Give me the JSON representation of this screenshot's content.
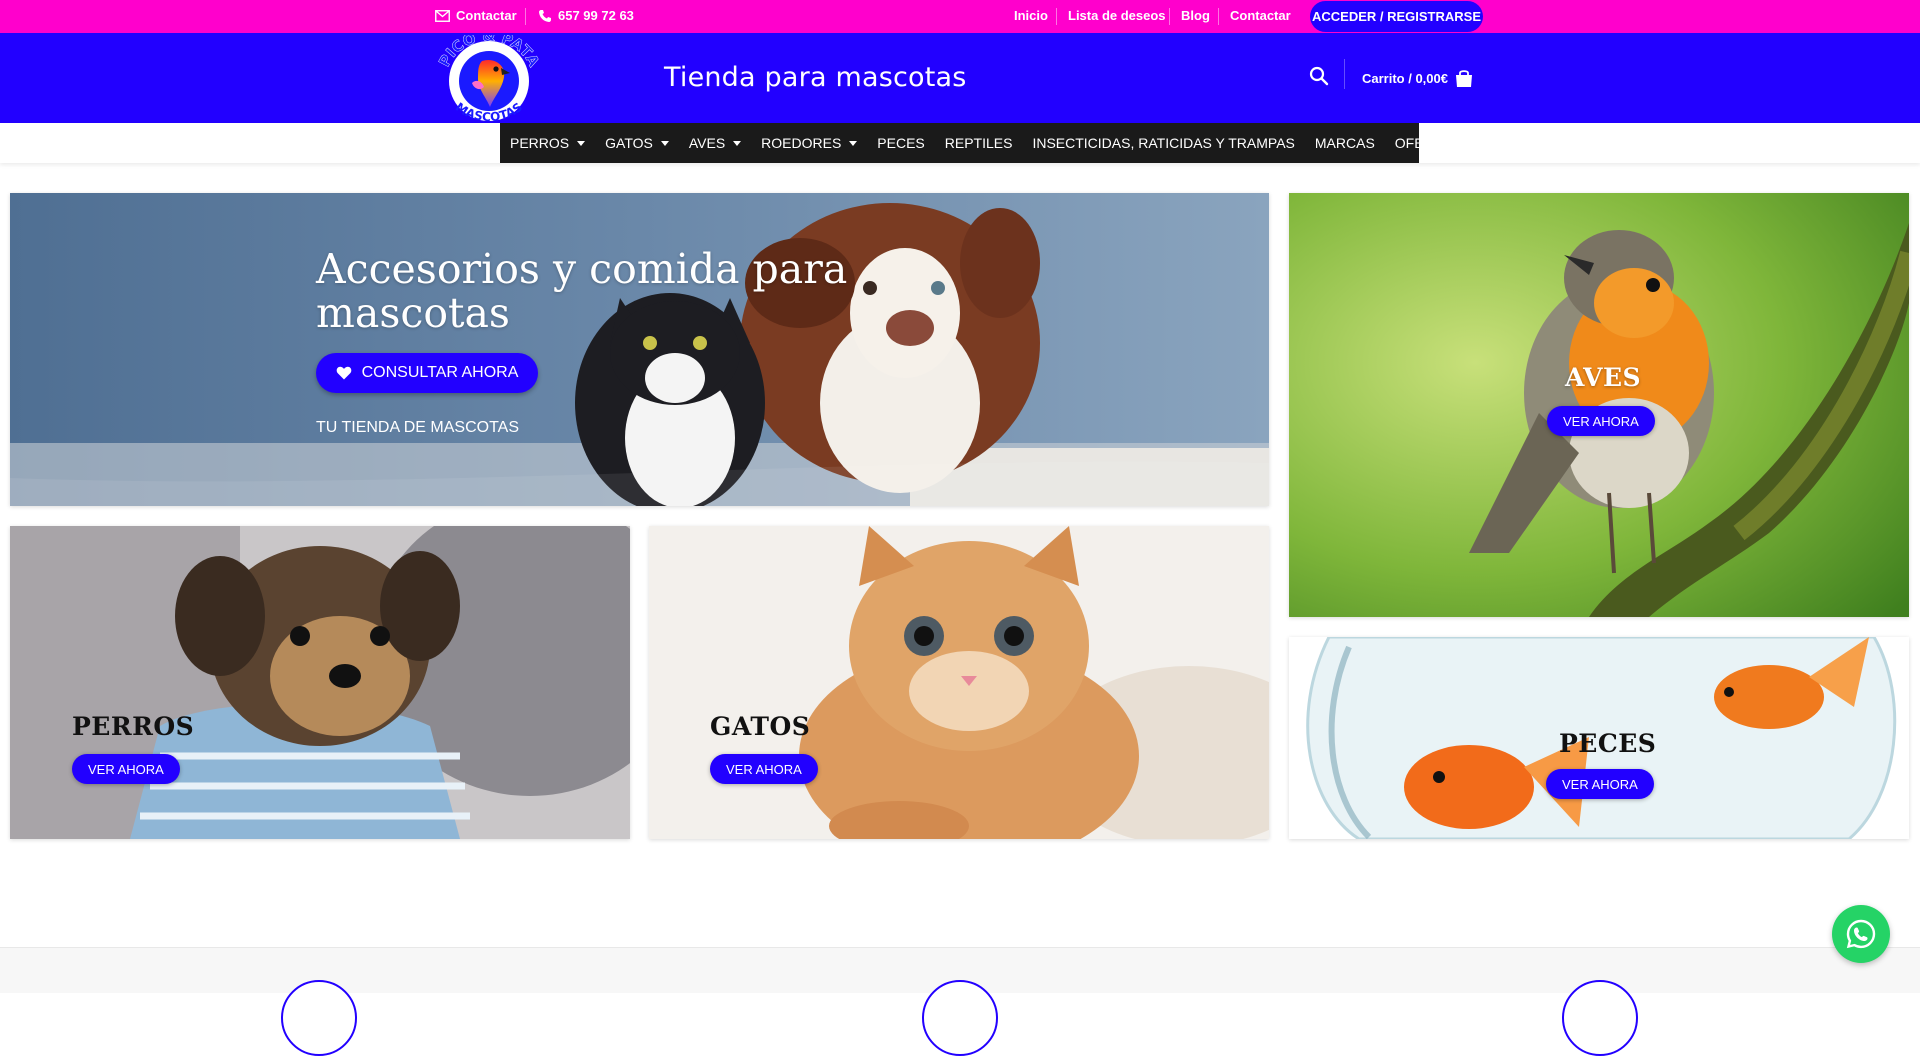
{
  "topbar": {
    "contact_label": "Contactar",
    "phone": "657 99 72 63",
    "links": [
      "Inicio",
      "Lista de deseos",
      "Blog",
      "Contactar"
    ],
    "login_label": "ACCEDER / REGISTRARSE"
  },
  "header": {
    "logo_top_text": "PICO & PATA",
    "logo_bottom_text": "MASCOTAS",
    "tagline": "Tienda para mascotas",
    "cart_label": "Carrito / 0,00€"
  },
  "nav": {
    "items": [
      {
        "label": "PERROS",
        "dropdown": true
      },
      {
        "label": "GATOS",
        "dropdown": true
      },
      {
        "label": "AVES",
        "dropdown": true
      },
      {
        "label": "ROEDORES",
        "dropdown": true
      },
      {
        "label": "PECES",
        "dropdown": false
      },
      {
        "label": "REPTILES",
        "dropdown": false
      },
      {
        "label": "INSECTICIDAS, RATICIDAS Y TRAMPAS",
        "dropdown": false
      },
      {
        "label": "MARCAS",
        "dropdown": false
      },
      {
        "label": "OFERTAS",
        "dropdown": false
      }
    ]
  },
  "hero": {
    "title": "Accesorios y comida para mascotas",
    "button_label": "CONSULTAR AHORA",
    "subtitle": "TU TIENDA DE MASCOTAS"
  },
  "categories": {
    "aves": {
      "title": "AVES",
      "button": "VER AHORA"
    },
    "perros": {
      "title": "PERROS",
      "button": "VER AHORA"
    },
    "gatos": {
      "title": "GATOS",
      "button": "VER AHORA"
    },
    "peces": {
      "title": "PECES",
      "button": "VER AHORA"
    }
  },
  "colors": {
    "topbar": "#ff00cc",
    "primary": "#2200ff",
    "nav_bg": "#1a1a1a",
    "whatsapp": "#25d366"
  },
  "icons": [
    "mail-icon",
    "phone-icon",
    "search-icon",
    "cart-bag-icon",
    "heart-icon",
    "whatsapp-icon"
  ]
}
